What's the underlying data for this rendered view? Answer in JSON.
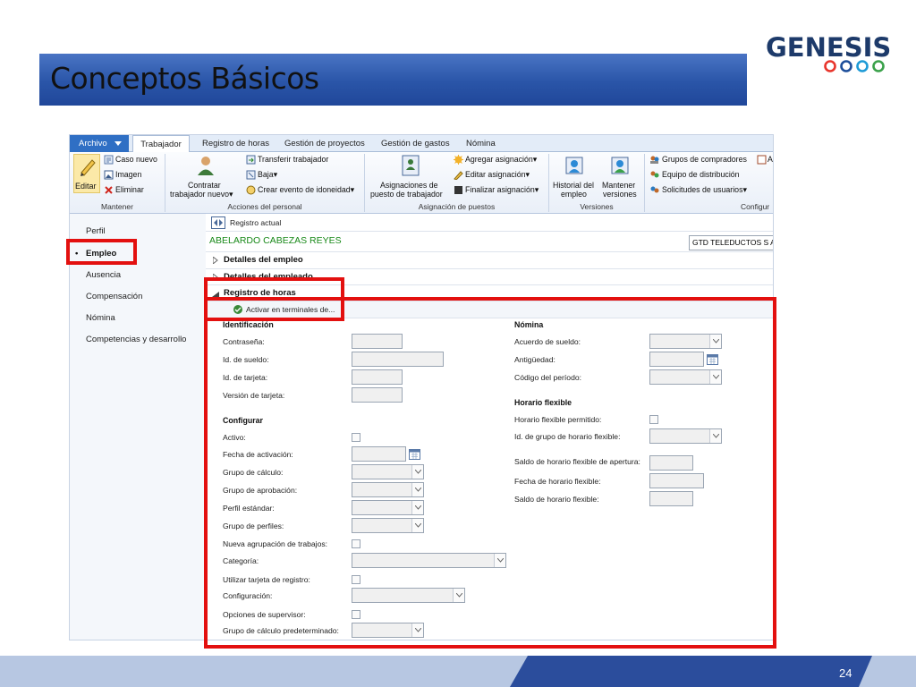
{
  "slide": {
    "title": "Conceptos Básicos",
    "logo_text": "GENESIS",
    "page_number": "24"
  },
  "colors": {
    "title_bar": "#2a55a8",
    "highlight": "#e3100f",
    "tab_active": "#2f6fc4",
    "record_green": "#1a8a1a",
    "footer": "#b7c7e2",
    "footer_dark": "#2b4d9c"
  },
  "tabs": [
    {
      "label": "Archivo",
      "icon": "chevron-down-icon"
    },
    {
      "label": "Trabajador"
    },
    {
      "label": "Registro de horas"
    },
    {
      "label": "Gestión de proyectos"
    },
    {
      "label": "Gestión de gastos"
    },
    {
      "label": "Nómina"
    }
  ],
  "ribbon": {
    "mantener": {
      "label": "Mantener",
      "editar": "Editar",
      "caso_nuevo": "Caso nuevo",
      "imagen": "Imagen",
      "eliminar": "Eliminar"
    },
    "acciones": {
      "label": "Acciones del personal",
      "contratar_1": "Contratar",
      "contratar_2": "trabajador nuevo▾",
      "transferir": "Transferir trabajador",
      "baja": "Baja▾",
      "crear_evento": "Crear evento de idoneidad▾"
    },
    "asignacion": {
      "label": "Asignación de puestos",
      "asignaciones_1": "Asignaciones de",
      "asignaciones_2": "puesto de trabajador",
      "agregar": "Agregar asignación▾",
      "editar": "Editar asignación▾",
      "finalizar": "Finalizar asignación▾"
    },
    "versiones": {
      "label": "Versiones",
      "historial_1": "Historial del",
      "historial_2": "empleo",
      "mantener_1": "Mantener",
      "mantener_2": "versiones"
    },
    "config": {
      "label": "Configur",
      "grupos": "Grupos de compradores",
      "equipo": "Equipo de distribución",
      "solicitudes": "Solicitudes de usuarios▾",
      "extra": "A"
    }
  },
  "nav": {
    "items": [
      "Perfil",
      "Empleo",
      "Ausencia",
      "Compensación",
      "Nómina",
      "Competencias y desarrollo"
    ],
    "selected": "Empleo"
  },
  "record": {
    "registro_actual": "Registro actual",
    "name": "ABELARDO CABEZAS REYES",
    "company": "GTD TELEDUCTOS S A"
  },
  "sections": {
    "detalles_empleo": "Detalles del empleo",
    "detalles_empleado": "Detalles del empleado",
    "registro_horas": "Registro de horas",
    "activar": "Activar en terminales de..."
  },
  "identificacion": {
    "heading": "Identificación",
    "fields": [
      "Contraseña:",
      "Id. de sueldo:",
      "Id. de tarjeta:",
      "Versión de tarjeta:"
    ]
  },
  "configurar": {
    "heading": "Configurar",
    "fields": [
      "Activo:",
      "Fecha de activación:",
      "Grupo de cálculo:",
      "Grupo de aprobación:",
      "Perfil estándar:",
      "Grupo de perfiles:",
      "Nueva agrupación de trabajos:",
      "Categoría:",
      "Utilizar tarjeta de registro:",
      "Configuración:",
      "Opciones de supervisor:",
      "Grupo de cálculo predeterminado:"
    ]
  },
  "nomina": {
    "heading": "Nómina",
    "fields": [
      "Acuerdo de sueldo:",
      "Antigüedad:",
      "Código del período:"
    ]
  },
  "horario": {
    "heading": "Horario flexible",
    "fields": [
      "Horario flexible permitido:",
      "Id. de grupo de horario flexible:",
      "Saldo de horario flexible de apertura:",
      "Fecha de horario flexible:",
      "Saldo de horario flexible:"
    ]
  }
}
